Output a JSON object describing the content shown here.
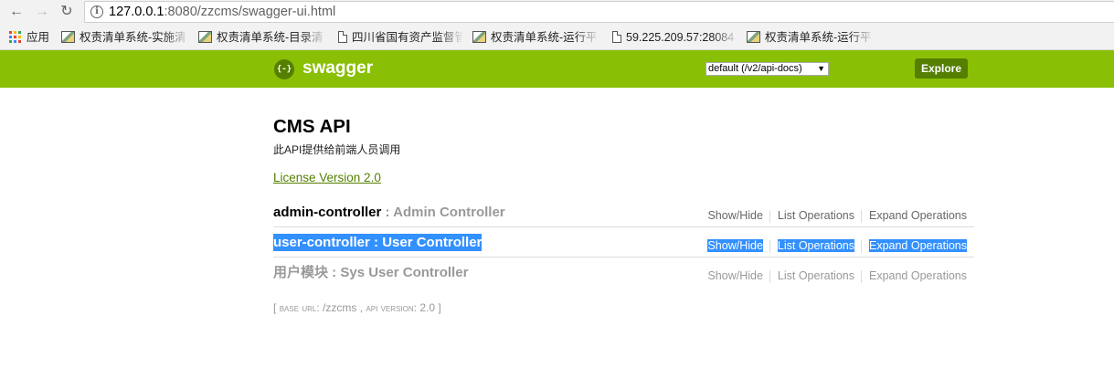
{
  "browser": {
    "url_host": "127.0.0.1",
    "url_rest": ":8080/zzcms/swagger-ui.html",
    "bookmarks": [
      {
        "label": "应用",
        "icon": "apps-grid-icon"
      },
      {
        "label": "权责清单系统-实施清",
        "icon": "image-icon"
      },
      {
        "label": "权责清单系统-目录清",
        "icon": "image-icon"
      },
      {
        "label": "四川省国有资产监督管",
        "icon": "document-icon"
      },
      {
        "label": "权责清单系统-运行平",
        "icon": "image-icon"
      },
      {
        "label": "59.225.209.57:28084",
        "icon": "document-icon"
      },
      {
        "label": "权责清单系统-运行平",
        "icon": "image-icon"
      }
    ]
  },
  "header": {
    "logo_glyph": "{-}",
    "logo_text": "swagger",
    "spec_select_value": "default (/v2/api-docs)",
    "explore_label": "Explore",
    "brand_color": "#89bf04",
    "dark_color": "#547f00"
  },
  "info": {
    "title": "CMS API",
    "description": "此API提供给前端人员调用",
    "license_label": "License Version 2.0"
  },
  "resources": [
    {
      "name": "admin-controller",
      "separator": " : ",
      "description": "Admin Controller",
      "ops": [
        "Show/Hide",
        "List Operations",
        "Expand Operations"
      ]
    },
    {
      "name": "user-controller",
      "separator": " : ",
      "description": "User Controller",
      "ops": [
        "Show/Hide",
        "List Operations",
        "Expand Operations"
      ]
    },
    {
      "name": "用户模块",
      "separator": " : ",
      "description": "Sys User Controller",
      "ops": [
        "Show/Hide",
        "List Operations",
        "Expand Operations"
      ]
    }
  ],
  "footer": {
    "open_bracket": "[",
    "base_url_label": "base url",
    "base_url_value": "/zzcms",
    "api_version_label": "api version",
    "api_version_value": "2.0",
    "close_bracket": "]"
  },
  "selection_color": "#3390ff"
}
